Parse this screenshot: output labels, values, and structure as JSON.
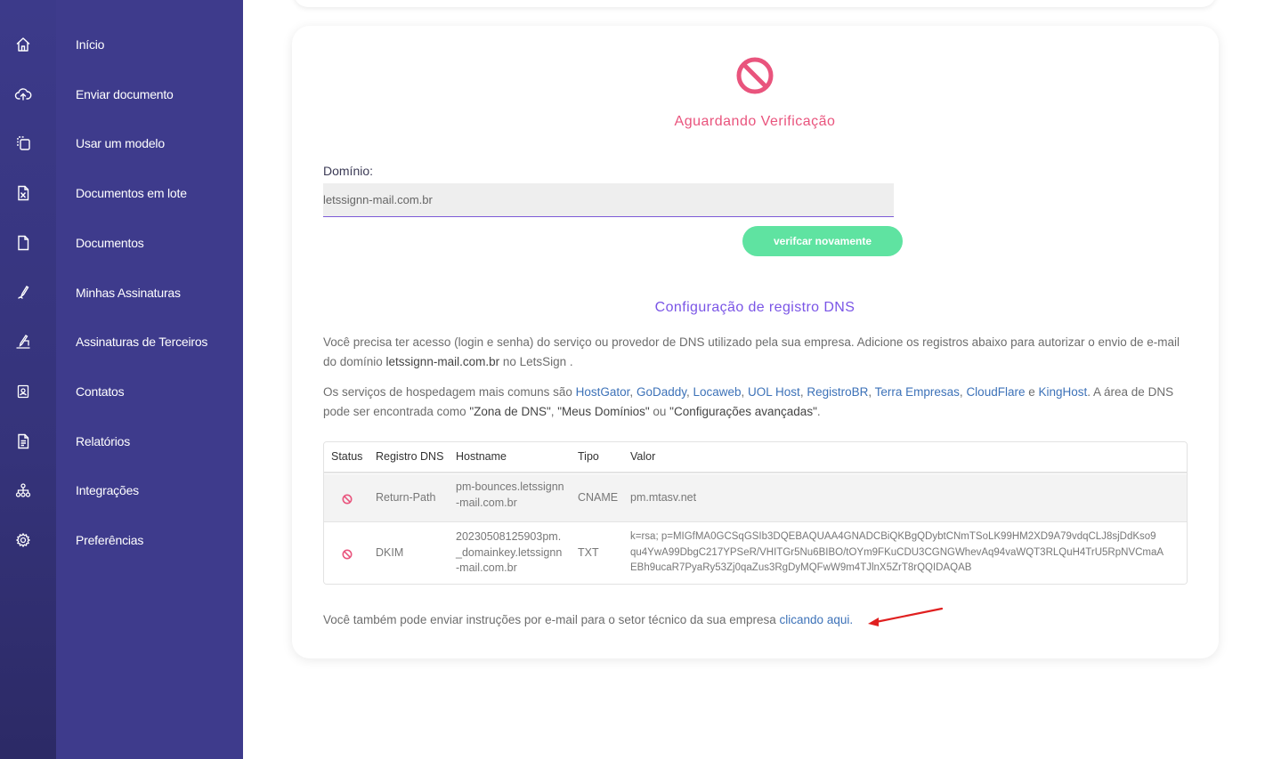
{
  "sidebar": {
    "items": [
      {
        "label": "Início",
        "icon": "home-icon"
      },
      {
        "label": "Enviar documento",
        "icon": "cloud-upload-icon"
      },
      {
        "label": "Usar um modelo",
        "icon": "copy-template-icon"
      },
      {
        "label": "Documentos em lote",
        "icon": "excel-file-icon"
      },
      {
        "label": "Documentos",
        "icon": "file-icon"
      },
      {
        "label": "Minhas Assinaturas",
        "icon": "pen-icon"
      },
      {
        "label": "Assinaturas de Terceiros",
        "icon": "signatures-icon"
      },
      {
        "label": "Contatos",
        "icon": "contact-icon"
      },
      {
        "label": "Relatórios",
        "icon": "report-icon"
      },
      {
        "label": "Integrações",
        "icon": "network-icon"
      },
      {
        "label": "Preferências",
        "icon": "gear-icon"
      }
    ]
  },
  "status": {
    "title": "Aguardando Verificação",
    "icon": "blocked-icon",
    "color": "#e9547d"
  },
  "domain": {
    "label": "Domínio:",
    "value": "letssignn-mail.com.br",
    "verify_label": "verifcar novamente"
  },
  "dns": {
    "title": "Configuração de registro DNS",
    "para1_a": "Você precisa ter acesso (login e senha) do serviço ou provedor de DNS utilizado pela sua empresa. Adicione os registros abaixo para autorizar o envio de e-mail do domínio ",
    "para1_domain": "letssignn-mail.com.br",
    "para1_b": " no LetsSign .",
    "para2_a": "Os serviços de hospedagem mais comuns são ",
    "providers": [
      "HostGator",
      "GoDaddy",
      "Locaweb",
      "UOL Host",
      "RegistroBR",
      "Terra Empresas",
      "CloudFlare",
      "KingHost"
    ],
    "sep_comma": ", ",
    "sep_and": " e ",
    "para2_b": ". A área de DNS pode ser encontrada como ",
    "zone1": "\"Zona de DNS\"",
    "comma": ", ",
    "zone2": "\"Meus Domínios\"",
    "or": " ou ",
    "zone3": "\"Configurações avançadas\"",
    "period": "."
  },
  "table": {
    "headers": [
      "Status",
      "Registro DNS",
      "Hostname",
      "Tipo",
      "Valor"
    ],
    "rows": [
      {
        "registro": "Return-Path",
        "hostname": "pm-bounces.letssignn\n-mail.com.br",
        "tipo": "CNAME",
        "valor": "pm.mtasv.net"
      },
      {
        "registro": "DKIM",
        "hostname": "20230508125903pm.\n_domainkey.letssignn\n-mail.com.br",
        "tipo": "TXT",
        "valor": "k=rsa; p=MIGfMA0GCSqGSIb3DQEBAQUAA4GNADCBiQKBgQDybtCNmTSoLK99HM2XD9A79vdqCLJ8sjDdKso9\nqu4YwA99DbgC217YPSeR/VHITGr5Nu6BIBO/tOYm9FKuCDU3CGNGWhevAq94vaWQT3RLQuH4TrU5RpNVCmaA\nEBh9ucaR7PyaRy53Zj0qaZus3RgDyMQFwW9m4TJlnX5ZrT8rQQIDAQAB"
      }
    ]
  },
  "footer": {
    "text": "Você também pode enviar instruções por e-mail para o setor técnico da sua empresa ",
    "link": "clicando aqui."
  },
  "colors": {
    "sidebar": "#3e3b8c",
    "accent_pink": "#e9547d",
    "accent_purple": "#7a55e6",
    "button_green": "#5fe3a1",
    "link": "#3d72b8",
    "annotation_arrow": "#e02020"
  }
}
